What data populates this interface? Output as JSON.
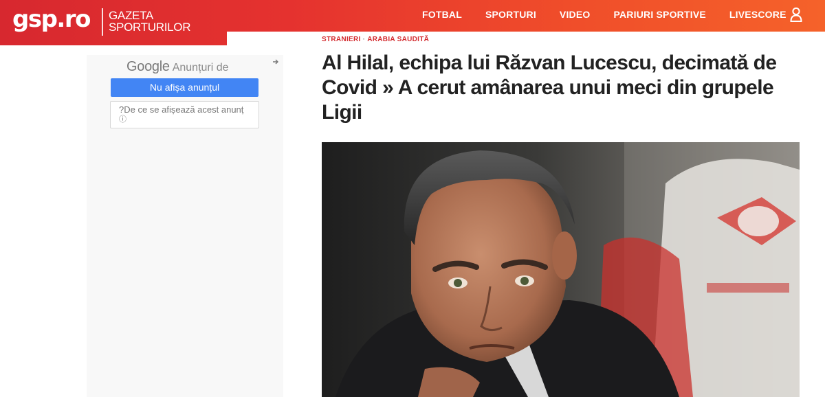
{
  "header": {
    "logo": "gsp.ro",
    "logo_sub_line1": "GAZETA",
    "logo_sub_line2": "SPORTURILOR",
    "nav": [
      "FOTBAL",
      "SPORTURI",
      "VIDEO",
      "PARIURI SPORTIVE",
      "LIVESCORE"
    ],
    "user_icon": "user-icon",
    "colors": {
      "brand_red": "#e5322f",
      "brand_orange": "#f5622a"
    }
  },
  "ad": {
    "google_label": "Google",
    "ads_by_label": "Anunțuri de",
    "arrow_icon": "arrow-icon",
    "hide_button": "Nu afișa anunțul",
    "why_text": "?De ce se afișează acest anunț",
    "info_icon": "info-icon",
    "button_color": "#4285f4"
  },
  "article": {
    "breadcrumb": [
      "STRANIERI",
      "ARABIA SAUDITĂ"
    ],
    "breadcrumb_color": "#d32a2e",
    "title": "Al Hilal, echipa lui Răzvan Lucescu, decimată de Covid » A cerut amânarea unui meci din grupele Ligii",
    "photo_alt": "photo-of-razvan-lucescu"
  }
}
